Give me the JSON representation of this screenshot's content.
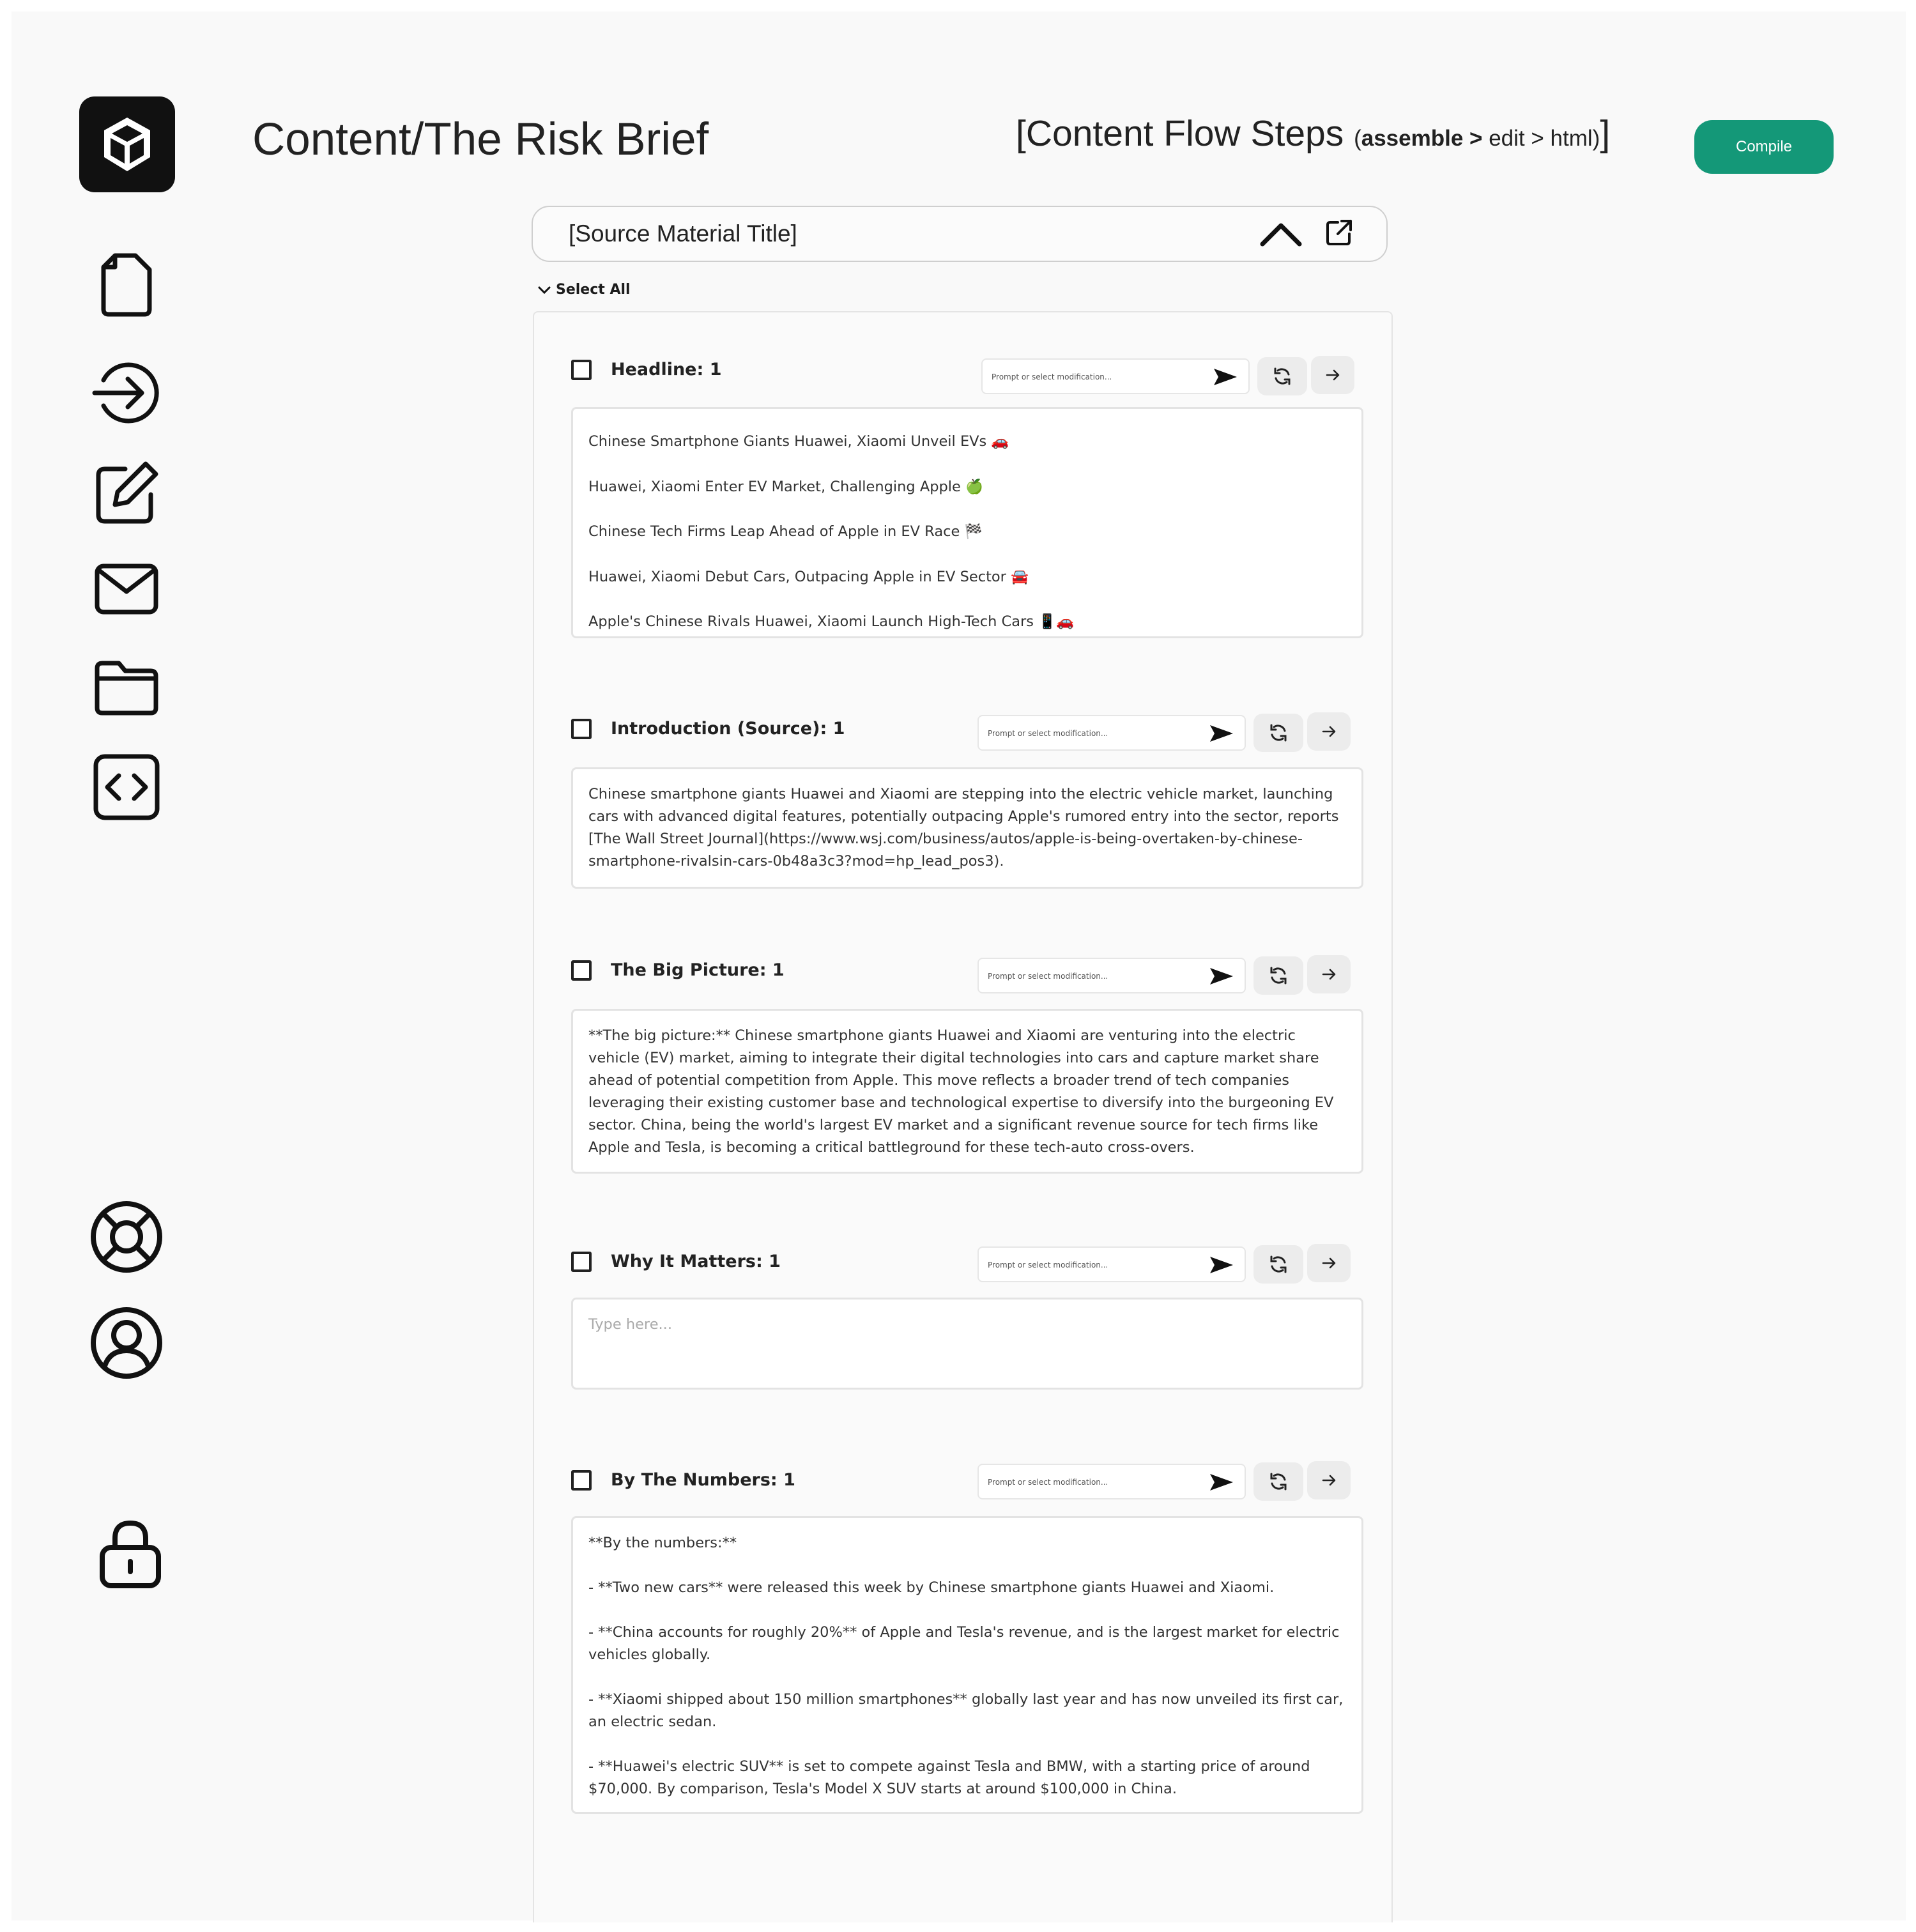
{
  "header": {
    "page_title": "Content/The Risk Brief",
    "flow_open": "[Content Flow Steps ",
    "flow_paren_open": "(",
    "flow_assemble": "assemble",
    "flow_sep1": " > ",
    "flow_edit": "edit",
    "flow_sep2": " > ",
    "flow_html": "html",
    "flow_paren_close": ")",
    "flow_close": "]",
    "compile_label": "Compile"
  },
  "sidebar": {
    "items": [
      {
        "icon": "document-icon"
      },
      {
        "icon": "import-arrow-icon"
      },
      {
        "icon": "edit-icon"
      },
      {
        "icon": "mail-icon"
      },
      {
        "icon": "folder-icon"
      },
      {
        "icon": "code-icon"
      },
      {
        "icon": "help-lifebuoy-icon"
      },
      {
        "icon": "user-icon"
      },
      {
        "icon": "lock-icon"
      }
    ]
  },
  "source": {
    "title": "[Source Material Title]",
    "select_all": "Select All"
  },
  "prompt_placeholder": "Prompt or select modification...",
  "sections": {
    "headline": {
      "label": "Headline: 1",
      "lines": [
        "Chinese Smartphone Giants Huawei, Xiaomi Unveil EVs 🚗",
        "Huawei, Xiaomi Enter EV Market, Challenging Apple 🍏",
        "Chinese Tech Firms Leap Ahead of Apple in EV Race 🏁",
        "Huawei, Xiaomi Debut Cars, Outpacing Apple in EV Sector 🚘",
        "Apple's Chinese Rivals Huawei, Xiaomi Launch High-Tech Cars 📱🚗"
      ]
    },
    "introduction": {
      "label": "Introduction (Source): 1",
      "text": "Chinese smartphone giants Huawei and Xiaomi are stepping into the electric vehicle market, launching cars with advanced digital features, potentially outpacing Apple's rumored entry into the sector, reports [The Wall Street Journal](https://www.wsj.com/business/autos/apple-is-being-overtaken-by-chinese-smartphone-rivalsin-cars-0b48a3c3?mod=hp_lead_pos3)."
    },
    "big_picture": {
      "label": "The Big Picture: 1",
      "text": "**The big picture:** Chinese smartphone giants Huawei and Xiaomi are venturing into the electric vehicle (EV) market, aiming to integrate their digital technologies into cars and capture market share ahead of potential competition from Apple. This move reflects a broader trend of tech companies leveraging their existing customer base and technological expertise to diversify into the burgeoning EV sector. China, being the world's largest EV market and a significant revenue source for tech firms like Apple and Tesla, is becoming a critical battleground for these tech-auto cross-overs."
    },
    "why_it_matters": {
      "label": "Why It Matters: 1",
      "placeholder": "Type here..."
    },
    "by_the_numbers": {
      "label": "By The Numbers: 1",
      "heading": "**By the numbers:**",
      "items": [
        "- **Two new cars** were released this week by Chinese smartphone giants Huawei and Xiaomi.",
        "- **China accounts for roughly 20%** of Apple and Tesla's revenue, and is the largest market for electric vehicles globally.",
        "- **Xiaomi shipped about 150 million smartphones** globally last year and has now unveiled its first car, an electric sedan.",
        "- **Huawei's electric SUV** is set to compete against Tesla and BMW, with a starting price of around $70,000. By comparison, Tesla's Model X SUV starts at around $100,000 in China."
      ]
    }
  }
}
